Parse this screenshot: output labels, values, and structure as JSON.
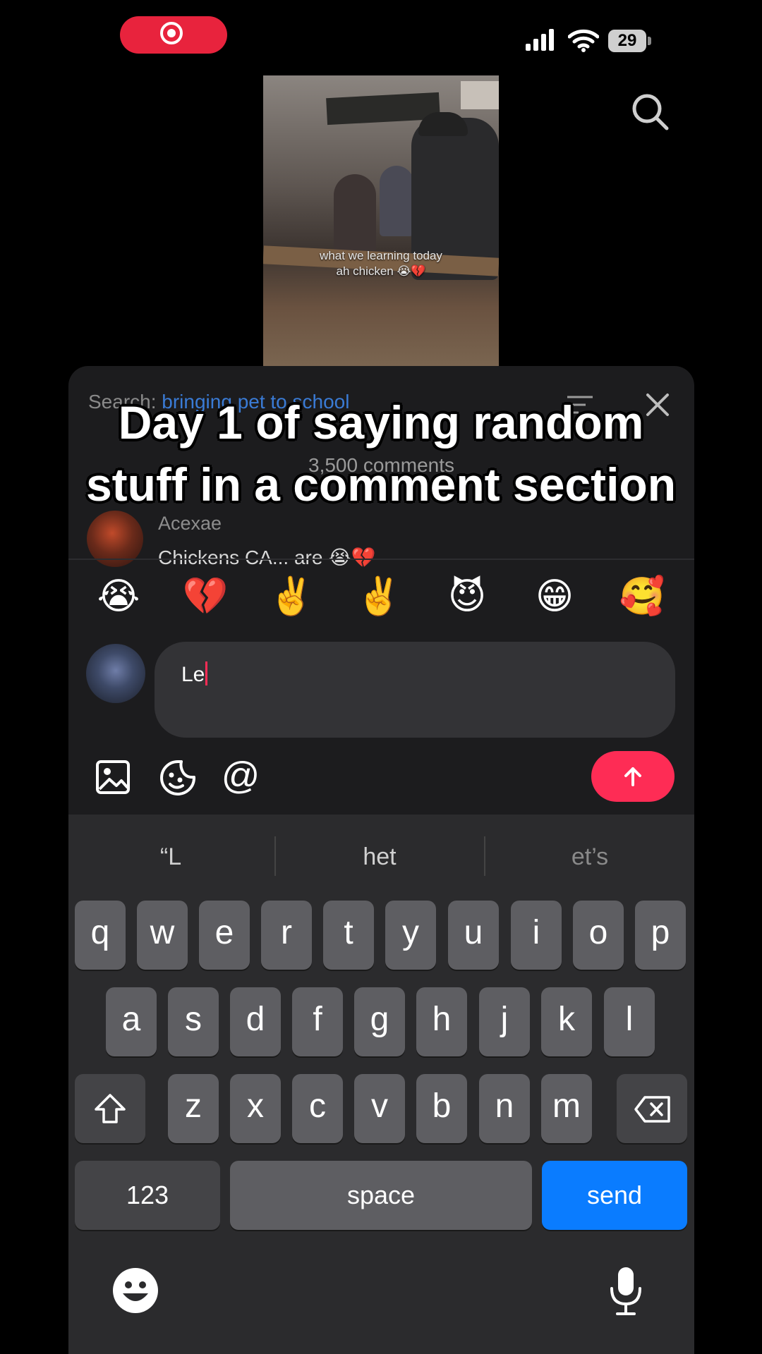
{
  "status": {
    "battery": "29"
  },
  "video": {
    "caption_line1": "what we learning today",
    "caption_line2": "ah chicken 😭💔"
  },
  "panel": {
    "search_prefix": "Search:",
    "search_query": "bringing pet to school",
    "comment_count": "3,500 comments",
    "comment_user": "Acexae",
    "comment_text": "Chickens CA... are 😭💔"
  },
  "overlay_title": "Day 1 of saying random stuff in a comment section",
  "emoji_bar": [
    "😭",
    "💔",
    "✌️",
    "✌️",
    "😈",
    "😁",
    "🥰"
  ],
  "input": {
    "value": "Le"
  },
  "mention_symbol": "@",
  "keyboard": {
    "suggestions": [
      "“L",
      "het",
      "et’s"
    ],
    "row1": [
      "q",
      "w",
      "e",
      "r",
      "t",
      "y",
      "u",
      "i",
      "o",
      "p"
    ],
    "row2": [
      "a",
      "s",
      "d",
      "f",
      "g",
      "h",
      "j",
      "k",
      "l"
    ],
    "row3": [
      "z",
      "x",
      "c",
      "v",
      "b",
      "n",
      "m"
    ],
    "numbers_label": "123",
    "space_label": "space",
    "send_label": "send"
  },
  "colors": {
    "accent": "#fe2c55",
    "send_key": "#0a7cff",
    "panel_bg": "#1c1c1e"
  }
}
